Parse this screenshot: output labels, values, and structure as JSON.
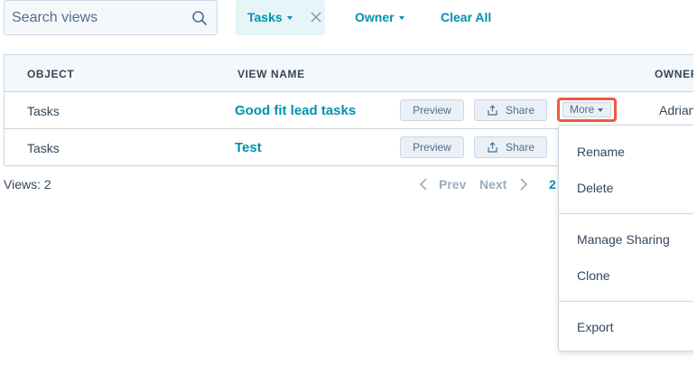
{
  "search": {
    "placeholder": "Search views"
  },
  "filters": {
    "tasks_label": "Tasks",
    "owner_label": "Owner",
    "clear_all_label": "Clear All"
  },
  "table": {
    "headers": {
      "object": "OBJECT",
      "view_name": "VIEW NAME",
      "owner": "OWNER"
    },
    "rows": [
      {
        "object": "Tasks",
        "name": "Good fit lead tasks",
        "preview": "Preview",
        "share": "Share",
        "more": "More",
        "owner": "Adrian"
      },
      {
        "object": "Tasks",
        "name": "Test",
        "preview": "Preview",
        "share": "Share"
      }
    ]
  },
  "footer": {
    "views_count": "Views: 2",
    "prev_label": "Prev",
    "next_label": "Next",
    "page": "2"
  },
  "more_menu": {
    "items": [
      "Rename",
      "Delete",
      "Manage Sharing",
      "Clone",
      "Export"
    ]
  },
  "colors": {
    "accent": "#0091ae",
    "highlight": "#f2583e",
    "border": "#cbd6e2",
    "text": "#33475b"
  }
}
